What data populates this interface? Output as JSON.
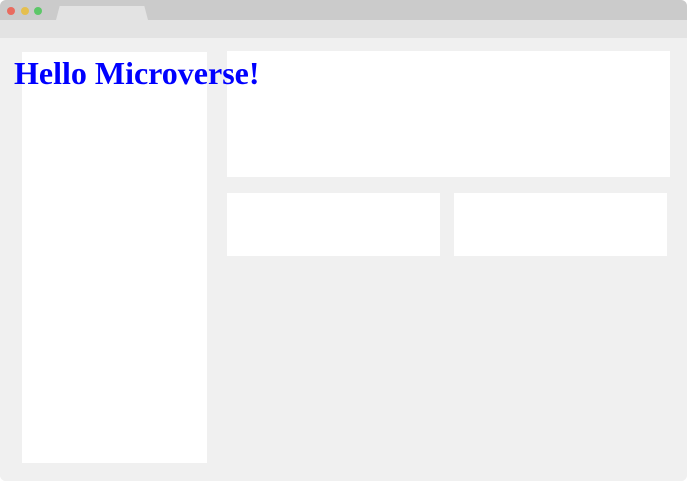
{
  "window": {
    "controls": [
      {
        "name": "close",
        "color": "#e96b5f"
      },
      {
        "name": "minimize",
        "color": "#e5bf4e"
      },
      {
        "name": "zoom",
        "color": "#5cc768"
      }
    ],
    "tab_title": ""
  },
  "page": {
    "heading": "Hello Microverse!",
    "heading_color": "#0000ff"
  }
}
